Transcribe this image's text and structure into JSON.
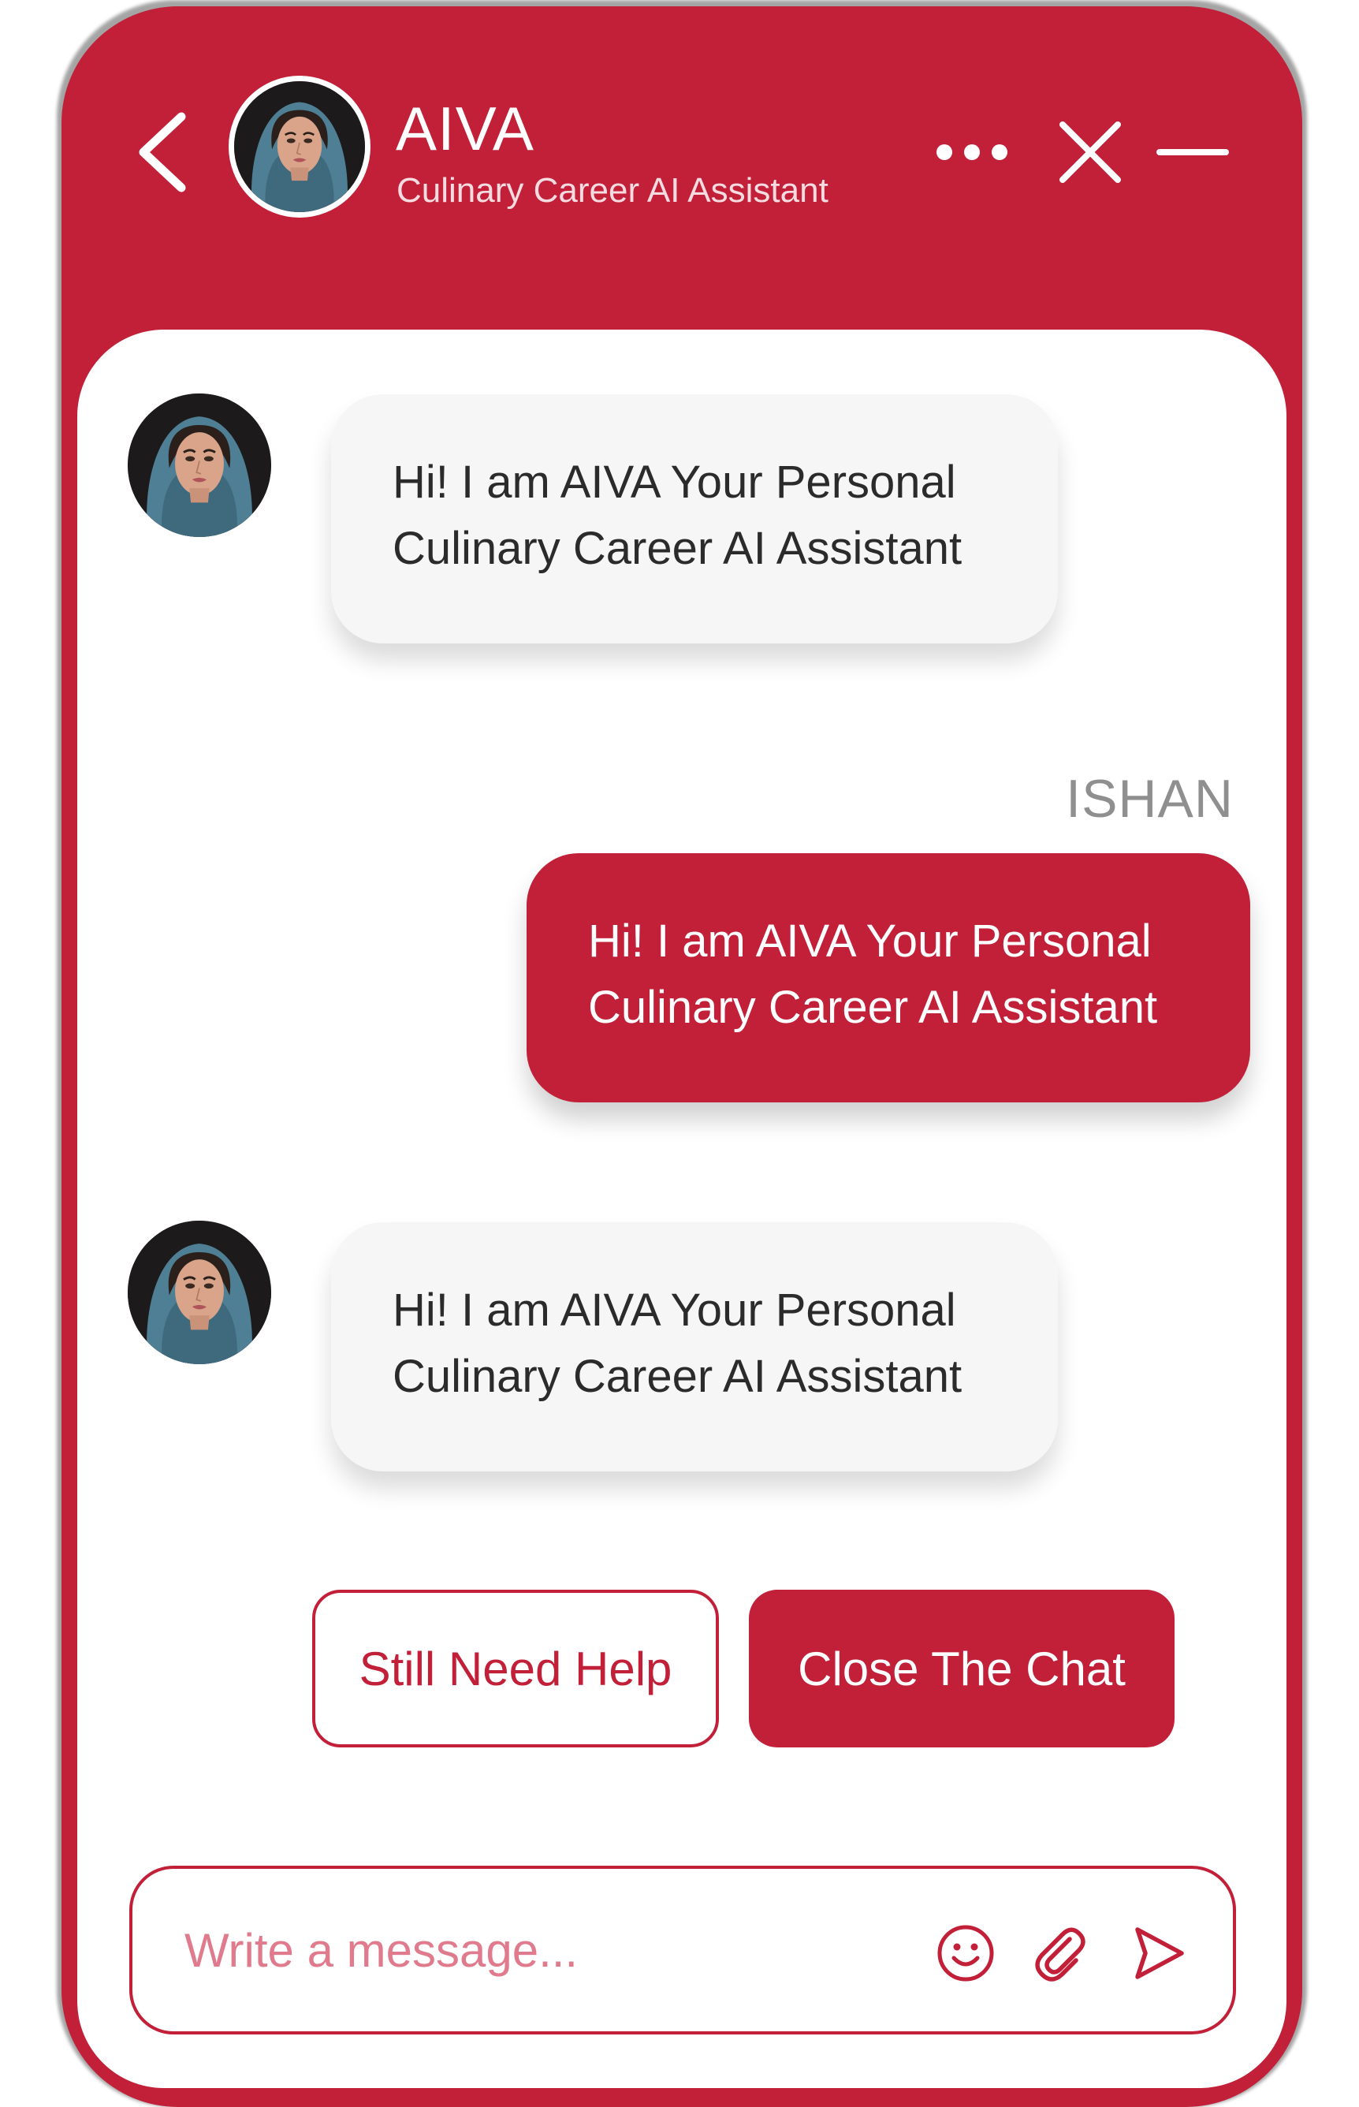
{
  "colors": {
    "accent": "#C21F39",
    "bot_bubble": "#F6F6F6",
    "placeholder": "#E07A8D",
    "sender_name": "#8F8F8F"
  },
  "header": {
    "title": "AIVA",
    "subtitle": "Culinary Career AI Assistant",
    "back_icon": "chevron-left-icon",
    "more_icon": "more-horizontal-icon",
    "close_icon": "close-icon",
    "minimize_icon": "minimize-icon",
    "avatar": "assistant-avatar"
  },
  "messages": [
    {
      "from": "bot",
      "text": "Hi! I am AIVA Your Personal\nCulinary Career AI Assistant"
    },
    {
      "from": "user",
      "sender": "ISHAN",
      "text": "Hi! I am AIVA Your Personal\nCulinary Career AI Assistant"
    },
    {
      "from": "bot",
      "text": "Hi! I am AIVA Your Personal\nCulinary Career AI Assistant"
    }
  ],
  "actions": {
    "still_need_help": "Still Need Help",
    "close_chat": "Close The Chat"
  },
  "composer": {
    "placeholder": "Write a message...",
    "emoji_icon": "smiley-icon",
    "attach_icon": "paperclip-icon",
    "send_icon": "send-icon"
  }
}
